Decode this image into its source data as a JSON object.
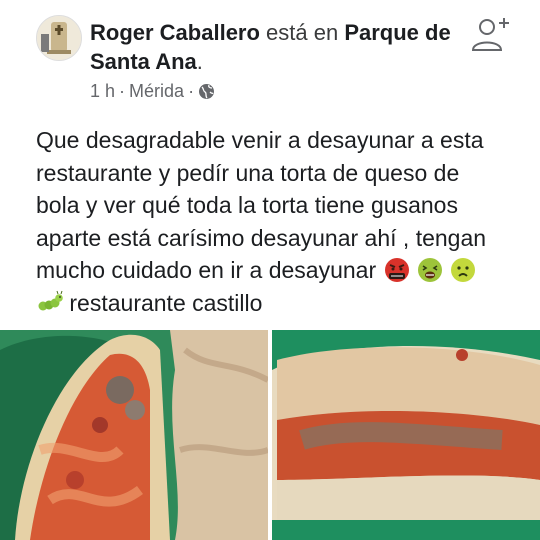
{
  "post": {
    "author": "Roger Caballero",
    "connector": " está en ",
    "place": "Parque de Santa Ana",
    "trailing": ".",
    "time": "1 h",
    "separator1": "·",
    "location": "Mérida",
    "separator2": "·",
    "audience_icon": "globe-icon",
    "text_line1": "Que desagradable venir a desayunar a esta",
    "text_line2": "restaurante y pedír una torta de queso de",
    "text_line3": "bola y ver qué toda la torta tiene gusanos",
    "text_line4": "aparte está carísimo desayunar ahí , tengan",
    "text_line5": "mucho cuidado en ir a desayunar",
    "text_line6": "restaurante castillo",
    "emojis": [
      "enraged-face-with-symbols-icon",
      "nauseated-face-icon",
      "sick-face-icon",
      "caterpillar-icon"
    ]
  },
  "header_icon": "add-friend-icon",
  "photos": [
    "sandwich-photo-left",
    "sandwich-photo-right"
  ]
}
